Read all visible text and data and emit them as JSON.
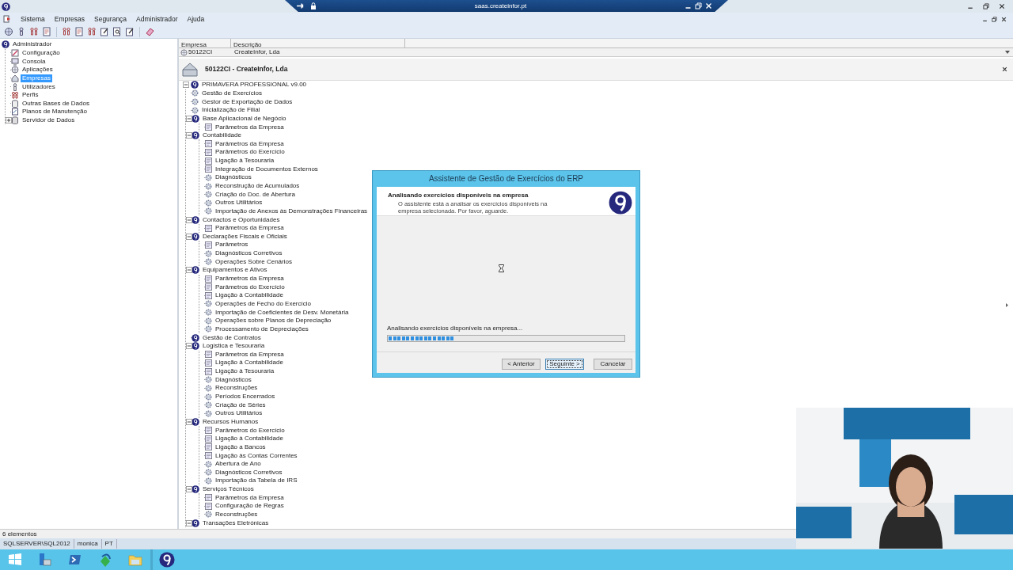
{
  "remote_bar": {
    "title": "saas.createinfor.pt"
  },
  "menu": [
    "Sistema",
    "Empresas",
    "Segurança",
    "Administrador",
    "Ajuda"
  ],
  "nav_tree": {
    "label": "Administrador",
    "selected": false,
    "children": [
      {
        "label": "Configuração",
        "selected": false
      },
      {
        "label": "Consola",
        "selected": false
      },
      {
        "label": "Aplicações",
        "selected": false
      },
      {
        "label": "Empresas",
        "selected": true
      },
      {
        "label": "Utilizadores",
        "selected": false
      },
      {
        "label": "Perfis",
        "selected": false
      },
      {
        "label": "Outras Bases de Dados",
        "selected": false
      },
      {
        "label": "Planos de Manutenção",
        "selected": false
      },
      {
        "label": "Servidor de Dados",
        "selected": false,
        "expanded": false
      }
    ]
  },
  "companies": {
    "columns": [
      "Empresa",
      "Descrição"
    ],
    "rows": [
      {
        "cells": [
          "50122CI",
          "CreateInfor, Lda"
        ]
      }
    ]
  },
  "company_header": "50122CI - CreateInfor, Lda",
  "module_tree": {
    "label": "PRIMAVERA PROFESSIONAL v9.00",
    "kind": "module",
    "expanded": true,
    "children": [
      {
        "label": "Gestão de Exercícios",
        "kind": "tool"
      },
      {
        "label": "Gestor de Exportação de Dados",
        "kind": "tool"
      },
      {
        "label": "Inicialização de Filial",
        "kind": "tool"
      },
      {
        "label": "Base Aplicacional de Negócio",
        "kind": "module",
        "expanded": true,
        "children": [
          {
            "label": "Parâmetros da Empresa",
            "kind": "params"
          }
        ]
      },
      {
        "label": "Contabilidade",
        "kind": "module",
        "expanded": true,
        "children": [
          {
            "label": "Parâmetros da Empresa",
            "kind": "params"
          },
          {
            "label": "Parâmetros do Exercício",
            "kind": "params"
          },
          {
            "label": "Ligação à Tesouraria",
            "kind": "params"
          },
          {
            "label": "Integração de Documentos Externos",
            "kind": "params"
          },
          {
            "label": "Diagnósticos",
            "kind": "tool"
          },
          {
            "label": "Reconstrução de Acumulados",
            "kind": "tool"
          },
          {
            "label": "Criação do Doc. de Abertura",
            "kind": "tool"
          },
          {
            "label": "Outros Utilitários",
            "kind": "tool"
          },
          {
            "label": "Importação de Anexos às Demonstrações Financeiras",
            "kind": "tool"
          }
        ]
      },
      {
        "label": "Contactos e Oportunidades",
        "kind": "module",
        "expanded": true,
        "children": [
          {
            "label": "Parâmetros da Empresa",
            "kind": "params"
          }
        ]
      },
      {
        "label": "Declarações Fiscais e Oficiais",
        "kind": "module",
        "expanded": true,
        "children": [
          {
            "label": "Parâmetros",
            "kind": "params"
          },
          {
            "label": "Diagnósticos Corretivos",
            "kind": "tool"
          },
          {
            "label": "Operações Sobre Cenários",
            "kind": "tool"
          }
        ]
      },
      {
        "label": "Equipamentos e Ativos",
        "kind": "module",
        "expanded": true,
        "children": [
          {
            "label": "Parâmetros da Empresa",
            "kind": "params"
          },
          {
            "label": "Parâmetros do Exercício",
            "kind": "params"
          },
          {
            "label": "Ligação à Contabilidade",
            "kind": "params"
          },
          {
            "label": "Operações de Fecho do Exercício",
            "kind": "tool"
          },
          {
            "label": "Importação de Coeficientes de Desv. Monetária",
            "kind": "tool"
          },
          {
            "label": "Operações sobre Planos de Depreciação",
            "kind": "tool"
          },
          {
            "label": "Processamento de Depreciações",
            "kind": "tool"
          }
        ]
      },
      {
        "label": "Gestão de Contratos",
        "kind": "module"
      },
      {
        "label": "Logística e Tesouraria",
        "kind": "module",
        "expanded": true,
        "children": [
          {
            "label": "Parâmetros da Empresa",
            "kind": "params"
          },
          {
            "label": "Ligação à Contabilidade",
            "kind": "params"
          },
          {
            "label": "Ligação à Tesouraria",
            "kind": "params"
          },
          {
            "label": "Diagnósticos",
            "kind": "tool"
          },
          {
            "label": "Reconstruções",
            "kind": "tool"
          },
          {
            "label": "Períodos Encerrados",
            "kind": "tool"
          },
          {
            "label": "Criação de Séries",
            "kind": "tool"
          },
          {
            "label": "Outros Utilitários",
            "kind": "tool"
          }
        ]
      },
      {
        "label": "Recursos Humanos",
        "kind": "module",
        "expanded": true,
        "children": [
          {
            "label": "Parâmetros do Exercício",
            "kind": "params"
          },
          {
            "label": "Ligação à Contabilidade",
            "kind": "params"
          },
          {
            "label": "Ligação a Bancos",
            "kind": "params"
          },
          {
            "label": "Ligação às Contas Correntes",
            "kind": "params"
          },
          {
            "label": "Abertura de Ano",
            "kind": "tool"
          },
          {
            "label": "Diagnósticos Corretivos",
            "kind": "tool"
          },
          {
            "label": "Importação da Tabela de IRS",
            "kind": "tool"
          }
        ]
      },
      {
        "label": "Serviços Técnicos",
        "kind": "module",
        "expanded": true,
        "children": [
          {
            "label": "Parâmetros da Empresa",
            "kind": "params"
          },
          {
            "label": "Configuração de Regras",
            "kind": "params"
          },
          {
            "label": "Reconstruções",
            "kind": "tool"
          }
        ]
      },
      {
        "label": "Transações Eletrónicas",
        "kind": "module",
        "expanded": true
      }
    ]
  },
  "dialog": {
    "title": "Assistente de Gestão de Exercícios do ERP",
    "heading": "Analisando exercícios disponíveis na empresa",
    "description": "O assistente está a analisar os exercícios disponíveis na empresa selecionada. Por favor, aguarde.",
    "progress_label": "Analisando exercícios disponíveis na empresa...",
    "progress": {
      "level": 0.28
    },
    "buttons": [
      {
        "label": "< Anterior",
        "focused": false
      },
      {
        "label": "Seguinte >",
        "focused": true
      },
      {
        "label": "Cancelar",
        "focused": false
      }
    ]
  },
  "item_count": "6 elementos",
  "status_bar": [
    "SQLSERVER\\SQL2012",
    "monica",
    "PT"
  ]
}
